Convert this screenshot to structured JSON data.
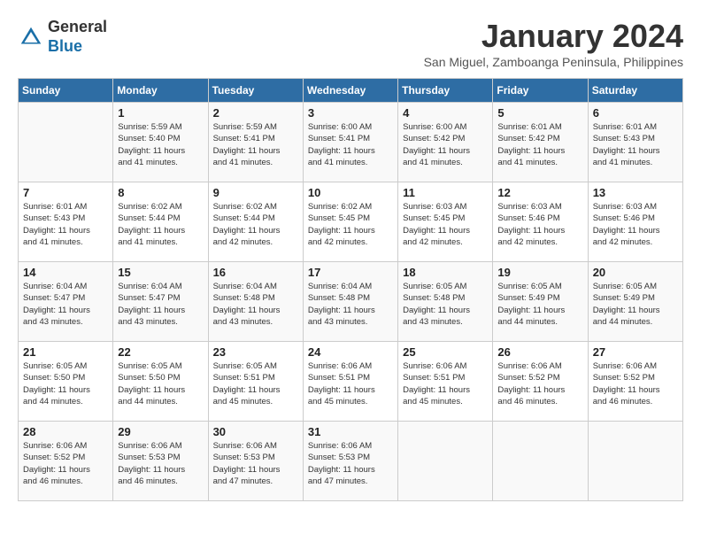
{
  "app": {
    "logo_general": "General",
    "logo_blue": "Blue"
  },
  "title": "January 2024",
  "location": "San Miguel, Zamboanga Peninsula, Philippines",
  "columns": [
    "Sunday",
    "Monday",
    "Tuesday",
    "Wednesday",
    "Thursday",
    "Friday",
    "Saturday"
  ],
  "weeks": [
    [
      {
        "day": "",
        "info": ""
      },
      {
        "day": "1",
        "info": "Sunrise: 5:59 AM\nSunset: 5:40 PM\nDaylight: 11 hours\nand 41 minutes."
      },
      {
        "day": "2",
        "info": "Sunrise: 5:59 AM\nSunset: 5:41 PM\nDaylight: 11 hours\nand 41 minutes."
      },
      {
        "day": "3",
        "info": "Sunrise: 6:00 AM\nSunset: 5:41 PM\nDaylight: 11 hours\nand 41 minutes."
      },
      {
        "day": "4",
        "info": "Sunrise: 6:00 AM\nSunset: 5:42 PM\nDaylight: 11 hours\nand 41 minutes."
      },
      {
        "day": "5",
        "info": "Sunrise: 6:01 AM\nSunset: 5:42 PM\nDaylight: 11 hours\nand 41 minutes."
      },
      {
        "day": "6",
        "info": "Sunrise: 6:01 AM\nSunset: 5:43 PM\nDaylight: 11 hours\nand 41 minutes."
      }
    ],
    [
      {
        "day": "7",
        "info": "Sunrise: 6:01 AM\nSunset: 5:43 PM\nDaylight: 11 hours\nand 41 minutes."
      },
      {
        "day": "8",
        "info": "Sunrise: 6:02 AM\nSunset: 5:44 PM\nDaylight: 11 hours\nand 41 minutes."
      },
      {
        "day": "9",
        "info": "Sunrise: 6:02 AM\nSunset: 5:44 PM\nDaylight: 11 hours\nand 42 minutes."
      },
      {
        "day": "10",
        "info": "Sunrise: 6:02 AM\nSunset: 5:45 PM\nDaylight: 11 hours\nand 42 minutes."
      },
      {
        "day": "11",
        "info": "Sunrise: 6:03 AM\nSunset: 5:45 PM\nDaylight: 11 hours\nand 42 minutes."
      },
      {
        "day": "12",
        "info": "Sunrise: 6:03 AM\nSunset: 5:46 PM\nDaylight: 11 hours\nand 42 minutes."
      },
      {
        "day": "13",
        "info": "Sunrise: 6:03 AM\nSunset: 5:46 PM\nDaylight: 11 hours\nand 42 minutes."
      }
    ],
    [
      {
        "day": "14",
        "info": "Sunrise: 6:04 AM\nSunset: 5:47 PM\nDaylight: 11 hours\nand 43 minutes."
      },
      {
        "day": "15",
        "info": "Sunrise: 6:04 AM\nSunset: 5:47 PM\nDaylight: 11 hours\nand 43 minutes."
      },
      {
        "day": "16",
        "info": "Sunrise: 6:04 AM\nSunset: 5:48 PM\nDaylight: 11 hours\nand 43 minutes."
      },
      {
        "day": "17",
        "info": "Sunrise: 6:04 AM\nSunset: 5:48 PM\nDaylight: 11 hours\nand 43 minutes."
      },
      {
        "day": "18",
        "info": "Sunrise: 6:05 AM\nSunset: 5:48 PM\nDaylight: 11 hours\nand 43 minutes."
      },
      {
        "day": "19",
        "info": "Sunrise: 6:05 AM\nSunset: 5:49 PM\nDaylight: 11 hours\nand 44 minutes."
      },
      {
        "day": "20",
        "info": "Sunrise: 6:05 AM\nSunset: 5:49 PM\nDaylight: 11 hours\nand 44 minutes."
      }
    ],
    [
      {
        "day": "21",
        "info": "Sunrise: 6:05 AM\nSunset: 5:50 PM\nDaylight: 11 hours\nand 44 minutes."
      },
      {
        "day": "22",
        "info": "Sunrise: 6:05 AM\nSunset: 5:50 PM\nDaylight: 11 hours\nand 44 minutes."
      },
      {
        "day": "23",
        "info": "Sunrise: 6:05 AM\nSunset: 5:51 PM\nDaylight: 11 hours\nand 45 minutes."
      },
      {
        "day": "24",
        "info": "Sunrise: 6:06 AM\nSunset: 5:51 PM\nDaylight: 11 hours\nand 45 minutes."
      },
      {
        "day": "25",
        "info": "Sunrise: 6:06 AM\nSunset: 5:51 PM\nDaylight: 11 hours\nand 45 minutes."
      },
      {
        "day": "26",
        "info": "Sunrise: 6:06 AM\nSunset: 5:52 PM\nDaylight: 11 hours\nand 46 minutes."
      },
      {
        "day": "27",
        "info": "Sunrise: 6:06 AM\nSunset: 5:52 PM\nDaylight: 11 hours\nand 46 minutes."
      }
    ],
    [
      {
        "day": "28",
        "info": "Sunrise: 6:06 AM\nSunset: 5:52 PM\nDaylight: 11 hours\nand 46 minutes."
      },
      {
        "day": "29",
        "info": "Sunrise: 6:06 AM\nSunset: 5:53 PM\nDaylight: 11 hours\nand 46 minutes."
      },
      {
        "day": "30",
        "info": "Sunrise: 6:06 AM\nSunset: 5:53 PM\nDaylight: 11 hours\nand 47 minutes."
      },
      {
        "day": "31",
        "info": "Sunrise: 6:06 AM\nSunset: 5:53 PM\nDaylight: 11 hours\nand 47 minutes."
      },
      {
        "day": "",
        "info": ""
      },
      {
        "day": "",
        "info": ""
      },
      {
        "day": "",
        "info": ""
      }
    ]
  ]
}
